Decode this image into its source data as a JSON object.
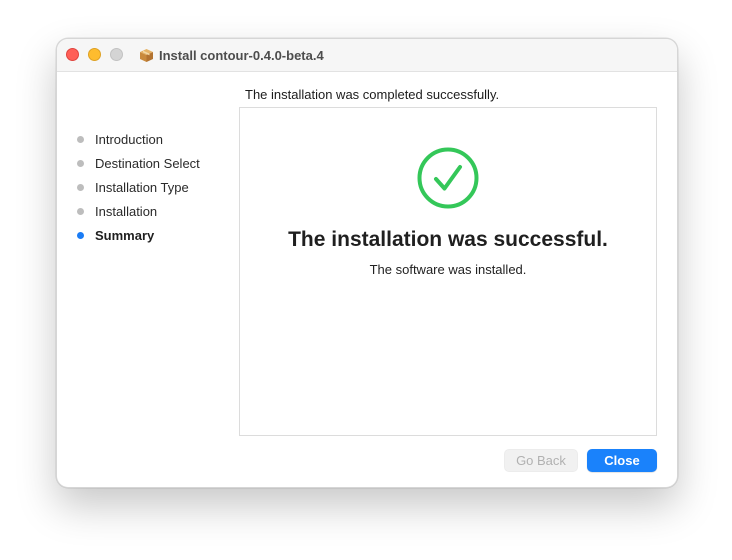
{
  "window": {
    "title": "Install contour-0.4.0-beta.4",
    "title_icon": "package-icon"
  },
  "header": {
    "text": "The installation was completed successfully."
  },
  "sidebar": {
    "steps": [
      {
        "label": "Introduction",
        "state": "done"
      },
      {
        "label": "Destination Select",
        "state": "done"
      },
      {
        "label": "Installation Type",
        "state": "done"
      },
      {
        "label": "Installation",
        "state": "done"
      },
      {
        "label": "Summary",
        "state": "current"
      }
    ]
  },
  "main": {
    "icon": "checkmark-circle-icon",
    "title": "The installation was successful.",
    "subtitle": "The software was installed."
  },
  "buttons": {
    "back_label": "Go Back",
    "back_enabled": false,
    "close_label": "Close"
  },
  "colors": {
    "accent": "#1a82fb",
    "success": "#34c759",
    "close_light": "#ff5f57",
    "minimize_light": "#febc2e",
    "zoom_light": "#d4d4d4"
  }
}
